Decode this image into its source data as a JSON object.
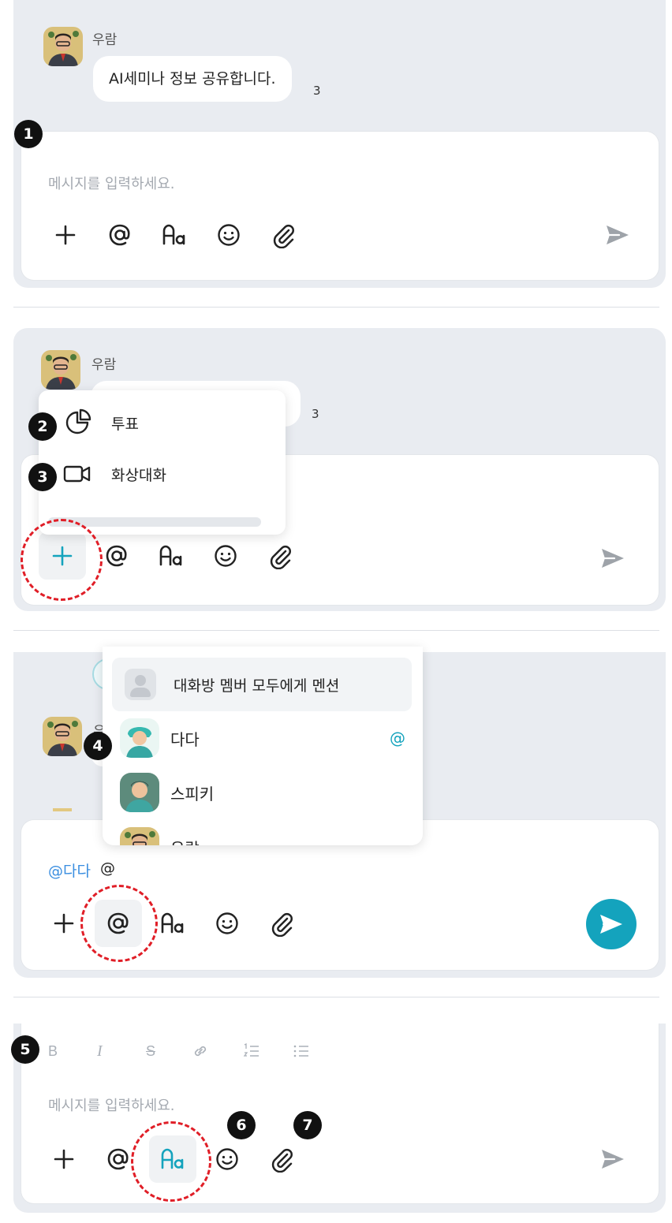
{
  "colors": {
    "accent": "#14a3bd",
    "badge": "#111111",
    "highlight": "#e01e27",
    "mention": "#3a8ee0"
  },
  "icons": [
    "plus-icon",
    "at-icon",
    "text-format-icon",
    "emoji-icon",
    "paperclip-icon",
    "send-icon",
    "poll-icon",
    "video-icon",
    "bold-icon",
    "italic-icon",
    "strikethrough-icon",
    "link-icon",
    "ordered-list-icon",
    "bullet-list-icon"
  ],
  "callouts": {
    "1": "1",
    "2": "2",
    "3": "3",
    "4": "4",
    "5": "5",
    "6": "6",
    "7": "7"
  },
  "panel1": {
    "sender": "우람",
    "message": "AI세미나 정보 공유합니다.",
    "read_count": "3",
    "placeholder": "메시지를 입력하세요."
  },
  "panel2": {
    "sender": "우람",
    "read_count": "3",
    "menu": [
      {
        "label": "투표"
      },
      {
        "label": "화상대화"
      }
    ]
  },
  "panel3": {
    "sender_partial": "우",
    "mention_all": "대화방 멤버 모두에게 멘션",
    "members": [
      {
        "name": "다다",
        "mark": "@"
      },
      {
        "name": "스피키"
      },
      {
        "name": "우람"
      }
    ],
    "mention_tag": "@다다",
    "typed": "@"
  },
  "panel4": {
    "format_labels": {
      "bold": "B",
      "italic": "I",
      "strike": "S"
    },
    "placeholder": "메시지를 입력하세요."
  }
}
